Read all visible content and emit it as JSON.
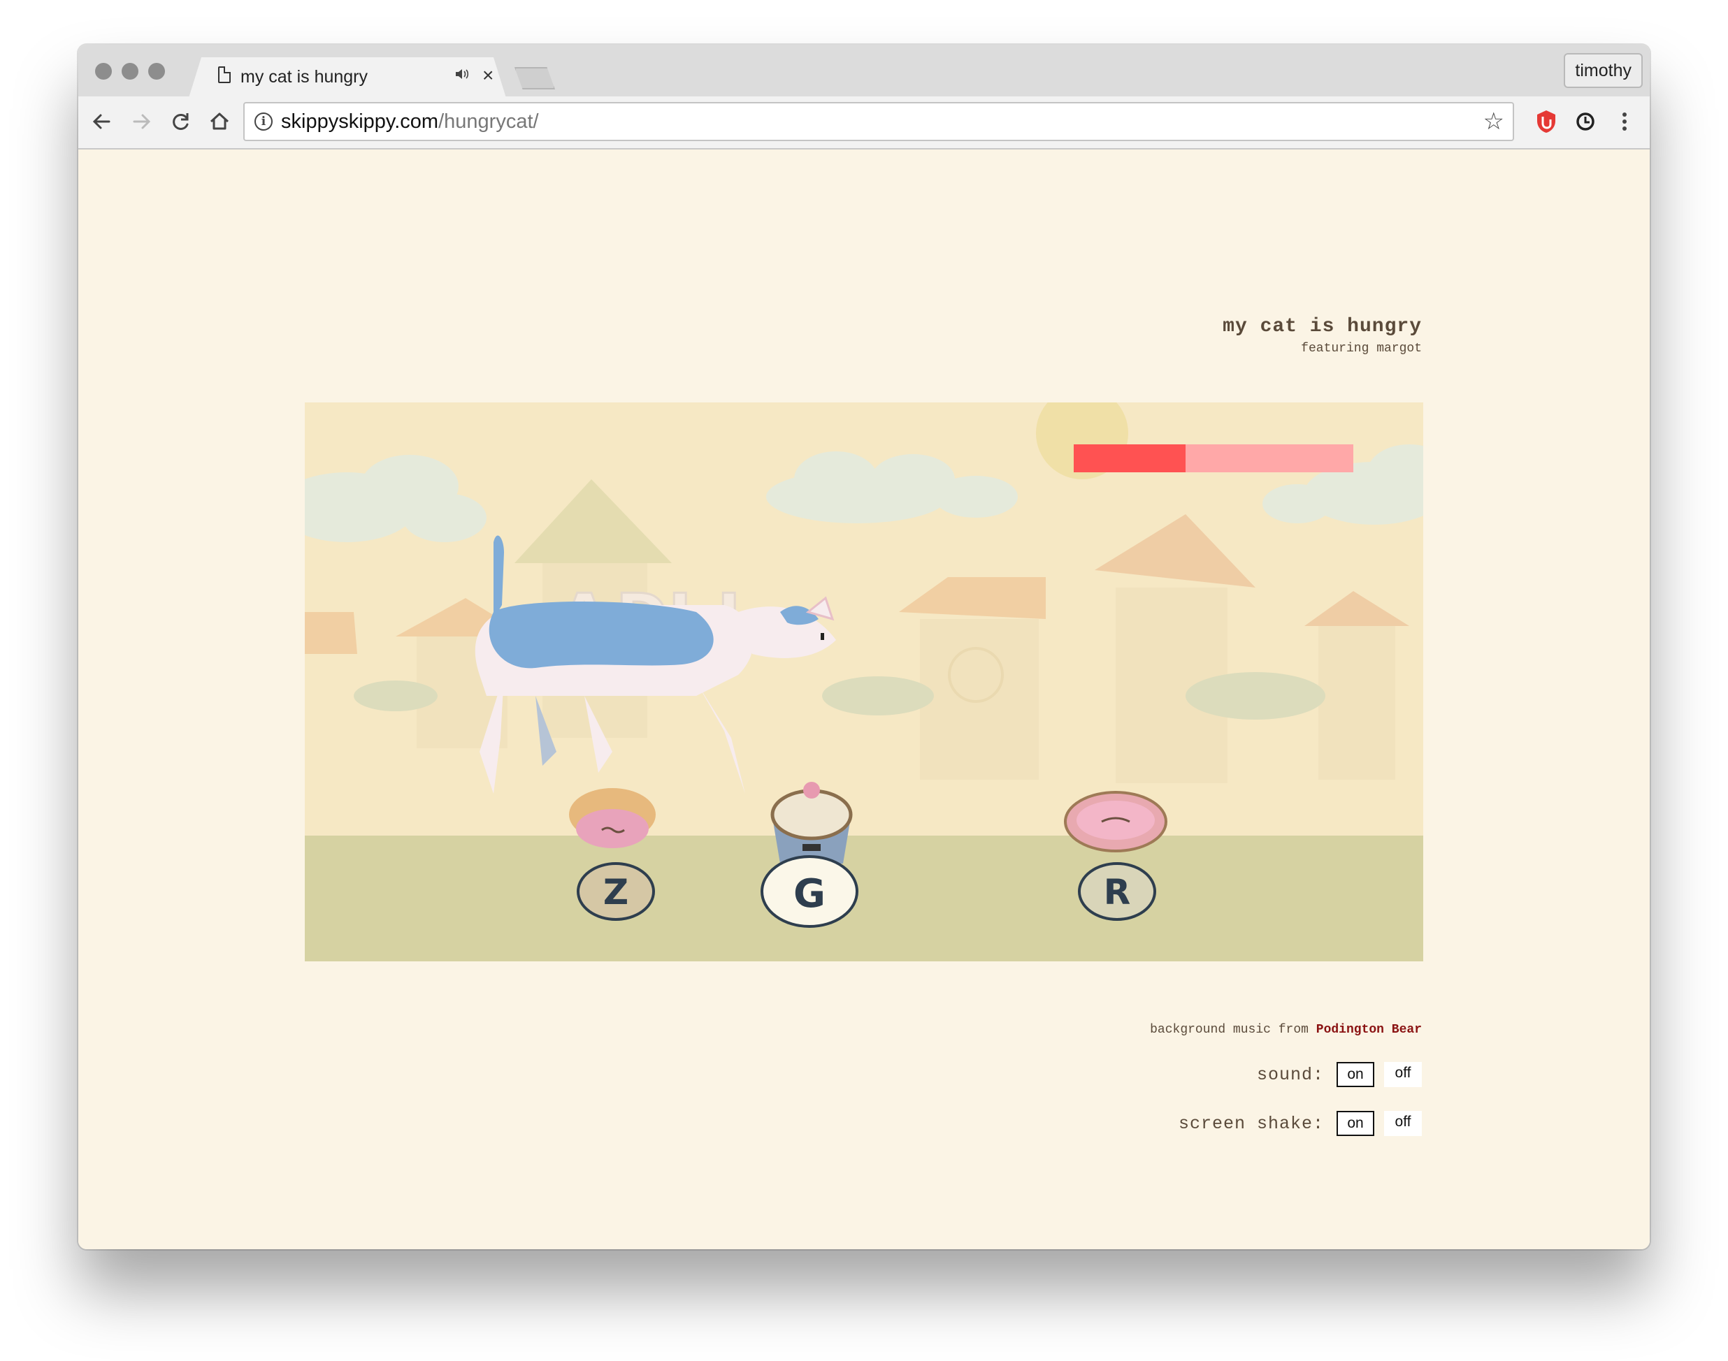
{
  "browser": {
    "tab_title": "my cat is hungry",
    "url_host": "skippyskippy.com",
    "url_path": "/hungrycat/",
    "profile_name": "timothy",
    "tab_close_glyph": "×"
  },
  "game": {
    "title": "my cat is hungry",
    "subtitle": "featuring margot",
    "hunger_meter": {
      "filled_fraction": 0.4,
      "fill_color": "#ff5252",
      "track_color": "#ffa8a8"
    },
    "background_letters": [
      "A",
      "D",
      "J",
      "L"
    ],
    "food_items": [
      {
        "name": "pie",
        "key": "Z"
      },
      {
        "name": "cupcake",
        "key": "G"
      },
      {
        "name": "donut",
        "key": "R"
      }
    ]
  },
  "footer": {
    "credit_prefix": "background music from",
    "credit_link": "Podington Bear",
    "sound_label": "sound:",
    "shake_label": "screen shake:",
    "on_label": "on",
    "off_label": "off",
    "sound_selected": "on",
    "shake_selected": "on"
  },
  "icons": [
    "back-arrow-icon",
    "forward-arrow-icon",
    "reload-icon",
    "home-icon",
    "info-icon",
    "star-icon",
    "adblock-icon",
    "timer-icon",
    "menu-dots-icon",
    "page-icon",
    "audio-icon",
    "close-icon"
  ]
}
